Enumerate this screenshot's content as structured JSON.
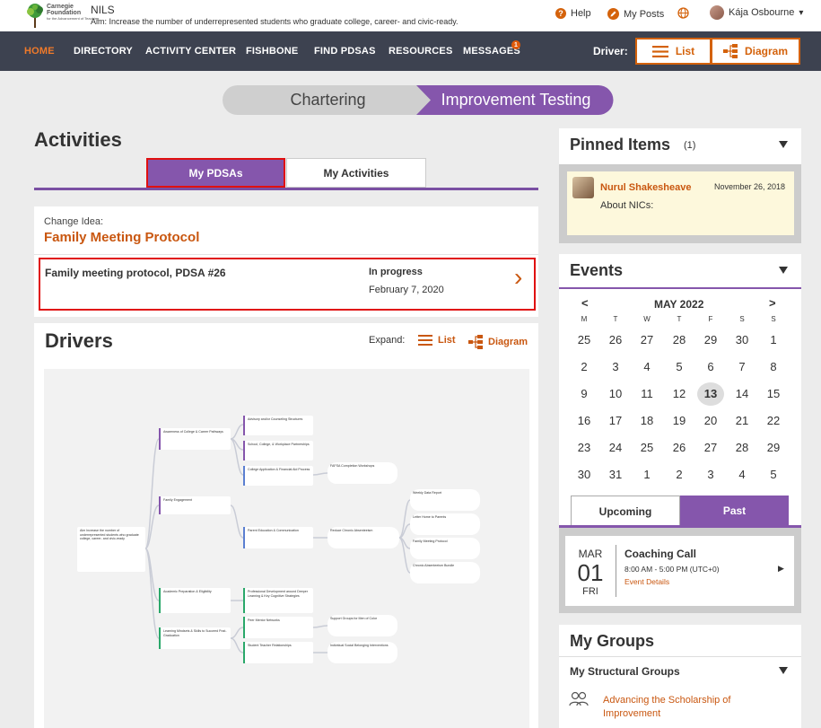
{
  "header": {
    "logo_line1": "Carnegie",
    "logo_line2": "Foundation",
    "logo_line3": "for the Advancement of Teaching",
    "app_name": "NILS",
    "aim": "Aim:  Increase the number of underrepresented students who graduate college, career- and civic-ready.",
    "help": "Help",
    "my_posts": "My Posts",
    "user_name": "Kája Osbourne",
    "help_icon_glyph": "?",
    "dropdown_glyph": "▾"
  },
  "nav": {
    "items": [
      "HOME",
      "DIRECTORY",
      "ACTIVITY CENTER",
      "FISHBONE",
      "FIND PDSAS",
      "RESOURCES",
      "MESSAGES"
    ],
    "messages_badge": "1",
    "driver_label": "Driver:",
    "list_button": "List",
    "diagram_button": "Diagram"
  },
  "phases": {
    "chartering": "Chartering",
    "improvement": "Improvement Testing"
  },
  "activities": {
    "title": "Activities",
    "tab_my_pdsas": "My PDSAs",
    "tab_my_activities": "My Activities",
    "change_idea_label": "Change Idea:",
    "change_idea_title": "Family Meeting Protocol",
    "pdsa_title": "Family meeting protocol, PDSA #26",
    "pdsa_status": "In progress",
    "pdsa_date": "February 7, 2020",
    "chevron": "›"
  },
  "drivers": {
    "title": "Drivers",
    "expand_label": "Expand:",
    "list_link": "List",
    "diagram_link": "Diagram",
    "aim_node": "Aim\nIncrease the number of underrepresented students who graduate college, career- and civic-ready",
    "primary": [
      "Awareness of College & Career Pathways",
      "Family Engagement",
      "Academic Preparation & Eligibility",
      "Learning Mindsets & Skills to Succeed Post-Graduation"
    ],
    "secondary": [
      "Advisory and/or Counseling Structures",
      "School, College, & Workplace Partnerships",
      "College Application & Financial Aid Process",
      "Parent Education & Communication",
      "Professional Development around Deeper Learning & Key Cognitive Strategies",
      "Peer Mentor Networks",
      "Student Teacher Relationships"
    ],
    "tertiary": [
      "FAFSA Completion Workshops",
      "Reduce Chronic Absenteeism",
      "Support Groups for Men of Color",
      "Individual Social Belonging Interventions"
    ],
    "change_ideas": [
      "Weekly Data Report",
      "Letter Home to Parents",
      "Family Meeting Protocol",
      "Chronic Absenteeism Bundle"
    ]
  },
  "pinned": {
    "title": "Pinned Items",
    "count": "(1)",
    "author": "Nurul Shakesheave",
    "date": "November 26, 2018",
    "text": "About NICs:"
  },
  "events": {
    "title": "Events",
    "month": "MAY 2022",
    "prev": "<",
    "next": ">",
    "dow": [
      "M",
      "T",
      "W",
      "T",
      "F",
      "S",
      "S"
    ],
    "weeks": [
      [
        "25",
        "26",
        "27",
        "28",
        "29",
        "30",
        "1"
      ],
      [
        "2",
        "3",
        "4",
        "5",
        "6",
        "7",
        "8"
      ],
      [
        "9",
        "10",
        "11",
        "12",
        "13",
        "14",
        "15"
      ],
      [
        "16",
        "17",
        "18",
        "19",
        "20",
        "21",
        "22"
      ],
      [
        "23",
        "24",
        "25",
        "26",
        "27",
        "28",
        "29"
      ],
      [
        "30",
        "31",
        "1",
        "2",
        "3",
        "4",
        "5"
      ]
    ],
    "today": "13",
    "tab_upcoming": "Upcoming",
    "tab_past": "Past",
    "event_month": "MAR",
    "event_day": "01",
    "event_weekday": "FRI",
    "event_title": "Coaching Call",
    "event_time": "8:00 AM - 5:00 PM (UTC+0)",
    "event_details": "Event Details",
    "play_glyph": "▶"
  },
  "groups": {
    "title": "My Groups",
    "structural": "My Structural Groups",
    "group_name": "Advancing the Scholarship of Improvement"
  },
  "colors": {
    "orange": "#c95710",
    "purple": "#8556ac",
    "nav_bg": "#3d4250"
  }
}
